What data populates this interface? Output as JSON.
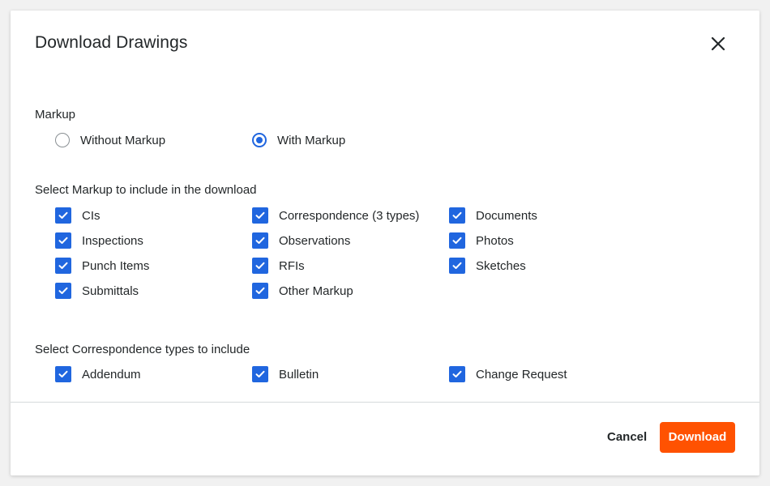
{
  "dialog": {
    "title": "Download Drawings",
    "close_icon": "close-icon"
  },
  "markup": {
    "label": "Markup",
    "options": [
      {
        "label": "Without Markup",
        "selected": false
      },
      {
        "label": "With Markup",
        "selected": true
      }
    ]
  },
  "markup_types": {
    "label": "Select Markup to include in the download",
    "items": [
      {
        "label": "CIs",
        "checked": true
      },
      {
        "label": "Correspondence (3 types)",
        "checked": true
      },
      {
        "label": "Documents",
        "checked": true
      },
      {
        "label": "Inspections",
        "checked": true
      },
      {
        "label": "Observations",
        "checked": true
      },
      {
        "label": "Photos",
        "checked": true
      },
      {
        "label": "Punch Items",
        "checked": true
      },
      {
        "label": "RFIs",
        "checked": true
      },
      {
        "label": "Sketches",
        "checked": true
      },
      {
        "label": "Submittals",
        "checked": true
      },
      {
        "label": "Other Markup",
        "checked": true
      }
    ]
  },
  "correspondence_types": {
    "label": "Select Correspondence types to include",
    "items": [
      {
        "label": "Addendum",
        "checked": true
      },
      {
        "label": "Bulletin",
        "checked": true
      },
      {
        "label": "Change Request",
        "checked": true
      }
    ]
  },
  "footer": {
    "cancel_label": "Cancel",
    "download_label": "Download"
  },
  "colors": {
    "accent_blue": "#2066df",
    "download_orange": "#ff5201",
    "text": "#232729"
  }
}
